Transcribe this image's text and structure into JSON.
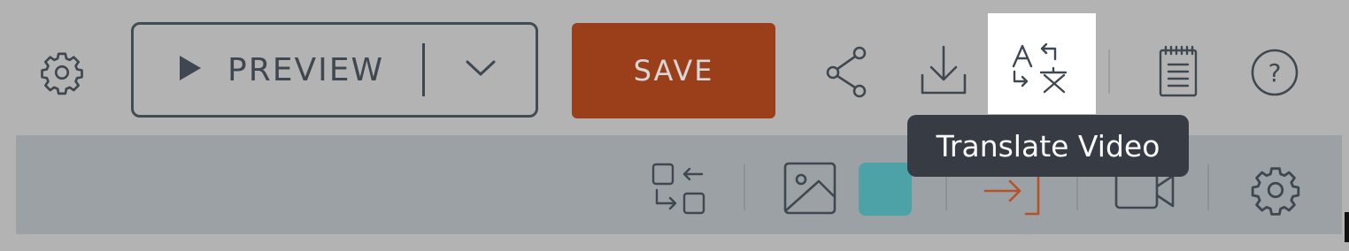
{
  "toolbar": {
    "preview_label": "PREVIEW",
    "save_label": "SAVE",
    "icons": {
      "settings": "gear-icon",
      "play": "play-icon",
      "caret": "chevron-down-icon",
      "share": "share-icon",
      "download": "download-icon",
      "translate": "translate-icon",
      "notes": "notepad-icon",
      "help": "help-icon"
    },
    "help_glyph": "?"
  },
  "tooltip": {
    "text": "Translate Video"
  },
  "secondary_toolbar": {
    "icons": {
      "swap": "swap-layout-icon",
      "image": "image-icon",
      "color": "color-swatch",
      "enter": "enter-icon",
      "video": "video-camera-icon",
      "settings": "gear-icon"
    }
  },
  "colors": {
    "save_background": "#9a3f1a",
    "swatch": "#4da2a7",
    "enter_icon": "#b4532a",
    "tooltip_background": "#363b44"
  }
}
